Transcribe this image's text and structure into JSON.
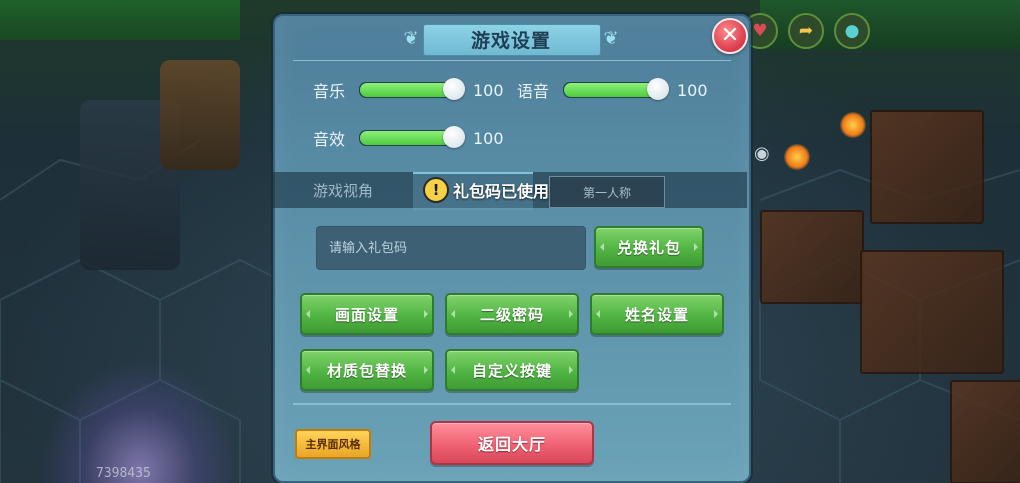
{
  "dialog": {
    "title": "游戏设置",
    "close_symbol": "✕"
  },
  "sliders": [
    {
      "label": "音乐",
      "value": "100",
      "level": 100
    },
    {
      "label": "语音",
      "value": "100",
      "level": 100
    },
    {
      "label": "音效",
      "value": "100",
      "level": 100
    }
  ],
  "view": {
    "label": "游戏视角",
    "option_right": "第一人称"
  },
  "toast": {
    "icon_symbol": "!",
    "text": "礼包码已使用"
  },
  "gift": {
    "placeholder": "请输入礼包码",
    "redeem_label": "兑换礼包"
  },
  "buttons": {
    "graphics": "画面设置",
    "second_password": "二级密码",
    "name_settings": "姓名设置",
    "texture_pack": "材质包替换",
    "custom_keys": "自定义按键",
    "main_ui_style": "主界面风格",
    "back_to_lobby": "返回大厅"
  },
  "background": {
    "corner_number": "7398435"
  },
  "colors": {
    "dialog_bg": "#5b90a8",
    "button_green": "#51b543",
    "button_red": "#f06273",
    "button_yellow": "#e9a524",
    "slider_fill": "#4fcb3e"
  }
}
